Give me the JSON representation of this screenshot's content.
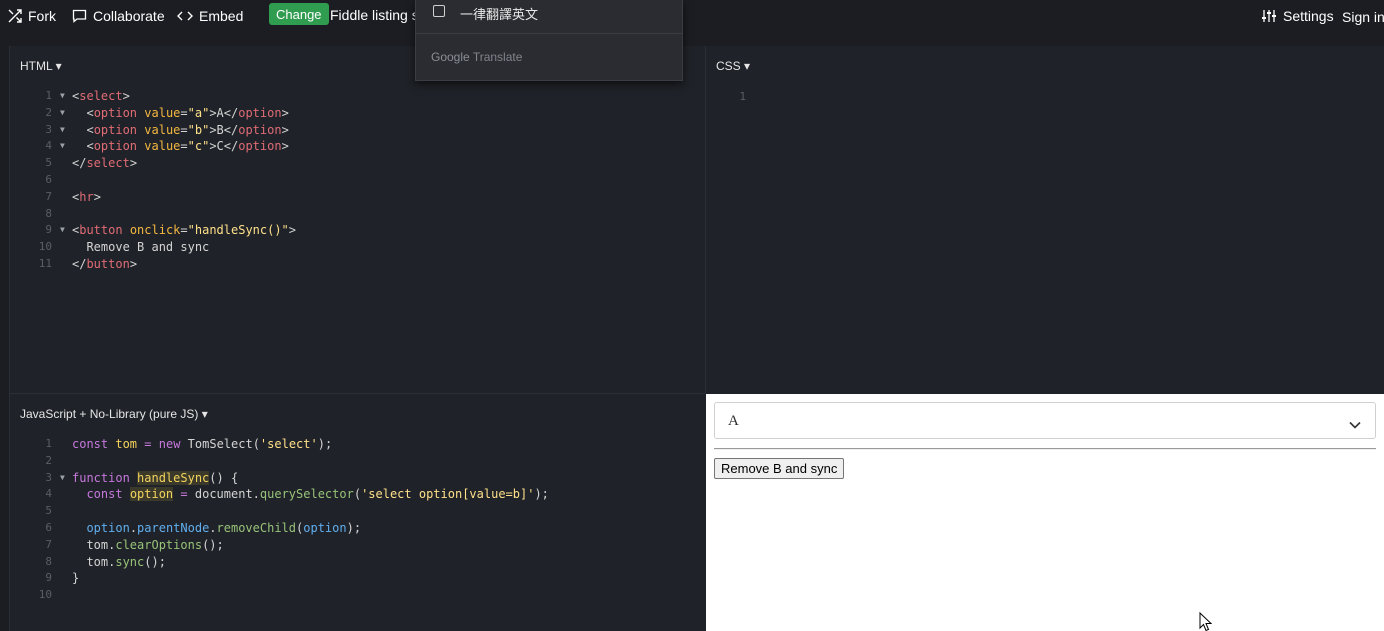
{
  "toolbar": {
    "fork": "Fork",
    "collaborate": "Collaborate",
    "embed": "Embed",
    "change": "Change",
    "fiddle_title": "Fiddle listing sl",
    "settings": "Settings",
    "sign_in": "Sign in"
  },
  "translate_popup": {
    "checkbox_label": "一律翻譯英文",
    "footer_google": "Google",
    "footer_translate": "Translate"
  },
  "panels": {
    "html_label": "HTML",
    "css_label": "CSS",
    "js_label": "JavaScript + No-Library (pure JS)"
  },
  "html_code": {
    "line_numbers": [
      "1",
      "2",
      "3",
      "4",
      "5",
      "6",
      "7",
      "8",
      "9",
      "10",
      "11"
    ]
  },
  "css_code": {
    "line_numbers": [
      "1"
    ]
  },
  "js_code": {
    "line_numbers": [
      "1",
      "2",
      "3",
      "4",
      "5",
      "6",
      "7",
      "8",
      "9",
      "10"
    ]
  },
  "result": {
    "select_value": "A",
    "button_label": "Remove B and sync"
  }
}
